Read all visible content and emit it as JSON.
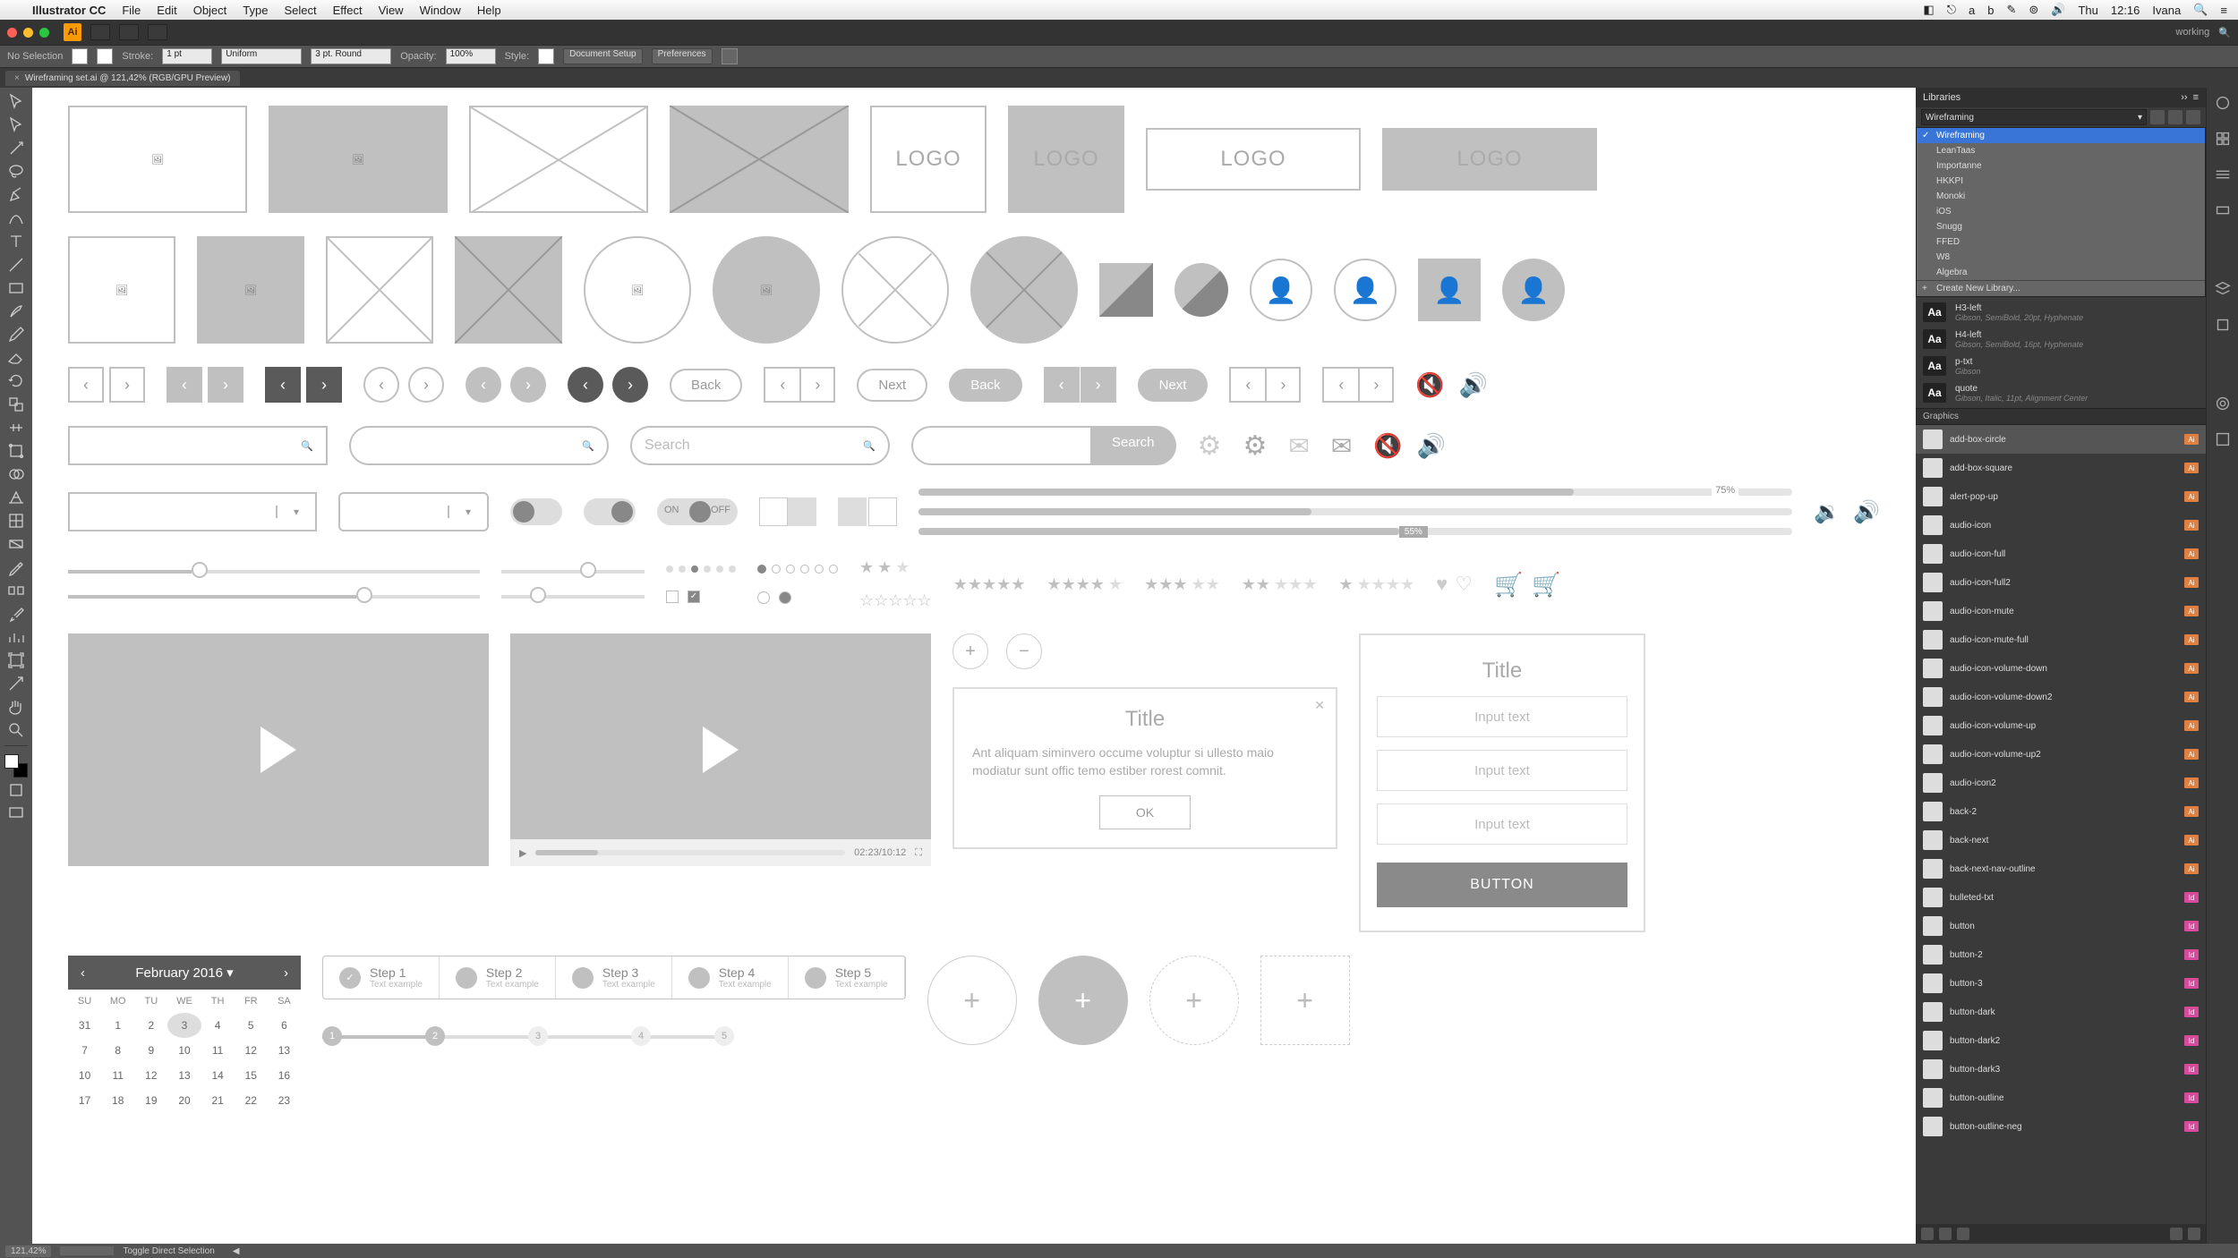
{
  "mac_menu": {
    "app": "Illustrator CC",
    "items": [
      "File",
      "Edit",
      "Object",
      "Type",
      "Select",
      "Effect",
      "View",
      "Window",
      "Help"
    ],
    "tray": {
      "day": "Thu",
      "time": "12:16",
      "user": "Ivana"
    }
  },
  "chrome": {
    "workspace": "working"
  },
  "controlbar": {
    "selection": "No Selection",
    "stroke_label": "Stroke:",
    "stroke_weight": "1 pt",
    "stroke_style": "Uniform",
    "brush": "3 pt. Round",
    "opacity_label": "Opacity:",
    "opacity": "100%",
    "style_label": "Style:",
    "btn_docsetup": "Document Setup",
    "btn_prefs": "Preferences"
  },
  "doctab": {
    "title": "Wireframing set.ai @ 121,42% (RGB/GPU Preview)"
  },
  "libraries": {
    "panel_title": "Libraries",
    "current": "Wireframing",
    "options": [
      "Wireframing",
      "LeanTaas",
      "Importanne",
      "HKKPI",
      "Monoki",
      "iOS",
      "Snugg",
      "FFED",
      "W8",
      "Algebra"
    ],
    "create": "Create New Library...",
    "text_styles": [
      {
        "name": "H3-left",
        "desc": "Gibson, SemiBold, 20pt, Hyphenate"
      },
      {
        "name": "H4-left",
        "desc": "Gibson, SemiBold, 16pt, Hyphenate"
      },
      {
        "name": "p-txt",
        "desc": "Gibson"
      },
      {
        "name": "quote",
        "desc": "Gibson, Italic, 11pt, Alignment Center"
      }
    ],
    "graphics_header": "Graphics",
    "graphics": [
      "add-box-circle",
      "add-box-square",
      "alert-pop-up",
      "audio-icon",
      "audio-icon-full",
      "audio-icon-full2",
      "audio-icon-mute",
      "audio-icon-mute-full",
      "audio-icon-volume-down",
      "audio-icon-volume-down2",
      "audio-icon-volume-up",
      "audio-icon-volume-up2",
      "audio-icon2",
      "back-2",
      "back-next",
      "back-next-nav-outline",
      "bulleted-txt",
      "button",
      "button-2",
      "button-3",
      "button-dark",
      "button-dark2",
      "button-dark3",
      "button-outline",
      "button-outline-neg"
    ],
    "tag_labels": {
      "ai": "Ai",
      "id": "Id"
    }
  },
  "statusbar": {
    "zoom": "121,42%",
    "tool": "Toggle Direct Selection"
  },
  "wireframe": {
    "logo": "LOGO",
    "back": "Back",
    "next": "Next",
    "search": "Search",
    "search_btn": "Search",
    "on": "ON",
    "off": "OFF",
    "percent_75": "75%",
    "percent_55": "55%",
    "video_time": "02:23/10:12",
    "modal_title": "Title",
    "modal_body": "Ant aliquam siminvero occume voluptur si ullesto maio modiatur sunt offic temo estiber rorest comnit.",
    "ok": "OK",
    "input_text": "Input text",
    "button": "BUTTON",
    "steps": [
      {
        "t": "Step 1",
        "s": "Text example"
      },
      {
        "t": "Step 2",
        "s": "Text example"
      },
      {
        "t": "Step 3",
        "s": "Text example"
      },
      {
        "t": "Step 4",
        "s": "Text example"
      },
      {
        "t": "Step 5",
        "s": "Text example"
      }
    ],
    "cal_month": "February 2016",
    "cal_days": [
      "SU",
      "MO",
      "TU",
      "WE",
      "TH",
      "FR",
      "SA"
    ],
    "cal_weeks": [
      [
        "31",
        "1",
        "2",
        "3",
        "4",
        "5",
        "6"
      ],
      [
        "7",
        "8",
        "9",
        "10",
        "11",
        "12",
        "13"
      ],
      [
        "10",
        "11",
        "12",
        "13",
        "14",
        "15",
        "16"
      ],
      [
        "17",
        "18",
        "19",
        "20",
        "21",
        "22",
        "23"
      ]
    ],
    "cal_current": "3"
  }
}
